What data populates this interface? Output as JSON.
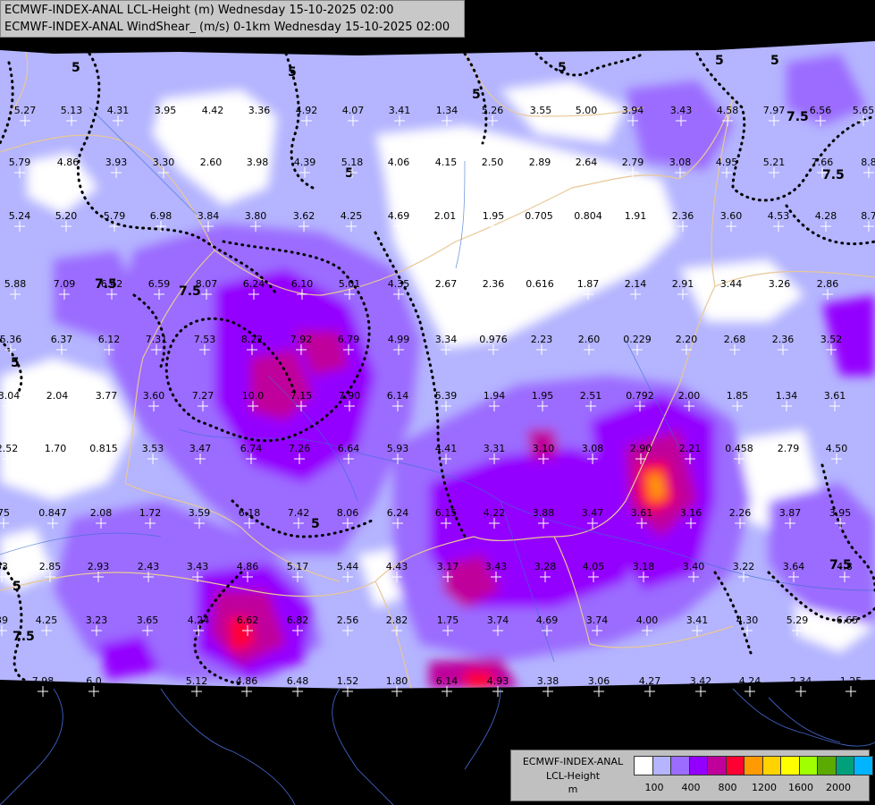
{
  "title": {
    "line1": "ECMWF-INDEX-ANAL LCL-Height (m) Wednesday 15-10-2025 02:00",
    "line2": "ECMWF-INDEX-ANAL WindShear_ (m/s) 0-1km Wednesday 15-10-2025 02:00"
  },
  "legend": {
    "line1": "ECMWF-INDEX-ANAL",
    "line2": "LCL-Height",
    "line3": "m",
    "colors": [
      "#ffffff",
      "#b4b4ff",
      "#9b6cff",
      "#9400ff",
      "#c0009b",
      "#ff0033",
      "#ff9a00",
      "#ffd300",
      "#ffff00",
      "#a0ff00",
      "#5aaa00",
      "#00a07a",
      "#00b4ff"
    ],
    "ticks": [
      "100",
      "400",
      "800",
      "1200",
      "1600",
      "2000"
    ]
  },
  "contour_labels": [
    "5",
    "5",
    "5",
    "5",
    "5",
    "5",
    "5",
    "7.5",
    "7.5",
    "7.5",
    "5",
    "5",
    "5",
    "7.5",
    "7.5",
    "7.5"
  ],
  "values": [
    "5.27",
    "5.13",
    "4.31",
    "3.95",
    "4.42",
    "3.36",
    "4.92",
    "4.07",
    "3.41",
    "1.34",
    "5.26",
    "3.55",
    "5.00",
    "3.94",
    "3.43",
    "4.58",
    "7.97",
    "6.56",
    "5.65",
    "5.79",
    "4.86",
    "3.93",
    "3.30",
    "2.60",
    "3.98",
    "4.39",
    "5.18",
    "4.06",
    "4.15",
    "2.50",
    "2.89",
    "2.64",
    "2.79",
    "3.08",
    "4.95",
    "5.21",
    "7.66",
    "8.8",
    "5.24",
    "5.20",
    "5.79",
    "6.98",
    "3.84",
    "3.80",
    "3.62",
    "4.25",
    "4.69",
    "2.01",
    "1.95",
    "0.705",
    "0.804",
    "1.91",
    "2.36",
    "3.60",
    "4.53",
    "4.28",
    "8.7",
    "5.88",
    "7.09",
    "6.42",
    "6.59",
    "8.07",
    "6.24",
    "6.10",
    "5.01",
    "4.35",
    "2.67",
    "2.36",
    "0.616",
    "1.87",
    "2.14",
    "2.91",
    "3.44",
    "3.26",
    "2.86",
    "5.36",
    "6.37",
    "6.12",
    "7.31",
    "7.53",
    "8.22",
    "7.92",
    "6.79",
    "4.99",
    "3.34",
    "0.976",
    "2.23",
    "2.60",
    "0.229",
    "2.20",
    "2.68",
    "2.36",
    "3.52",
    "3.04",
    "2.04",
    "3.77",
    "3.60",
    "7.27",
    "10.0",
    "7.15",
    "7.90",
    "6.14",
    "5.39",
    "1.94",
    "1.95",
    "2.51",
    "0.792",
    "2.00",
    "1.85",
    "1.34",
    "3.61",
    "2.52",
    "1.70",
    "0.815",
    "3.53",
    "3.47",
    "6.74",
    "7.26",
    "6.64",
    "5.93",
    "4.41",
    "3.31",
    "3.10",
    "3.08",
    "2.90",
    "2.21",
    "0.458",
    "2.79",
    "4.50",
    "75",
    "0.847",
    "2.08",
    "1.72",
    "3.59",
    "6.18",
    "7.42",
    "8.06",
    "6.24",
    "6.15",
    "4.22",
    "3.88",
    "3.47",
    "3.61",
    "3.16",
    "2.26",
    "3.87",
    "3.95",
    "53",
    "2.85",
    "2.93",
    "2.43",
    "3.43",
    "4.86",
    "5.17",
    "5.44",
    "4.43",
    "3.17",
    "3.43",
    "3.28",
    "4.05",
    "3.18",
    "3.40",
    "3.22",
    "3.64",
    "4.8",
    "39",
    "4.25",
    "3.23",
    "3.65",
    "4.24",
    "6.62",
    "6.82",
    "2.56",
    "2.82",
    "1.75",
    "3.74",
    "4.69",
    "3.74",
    "4.00",
    "3.41",
    "4.30",
    "5.29",
    "6.65",
    "7.98",
    "6.0",
    "5.12",
    "4.86",
    "6.48",
    "1.52",
    "1.80",
    "6.14",
    "4.93",
    "3.38",
    "3.06",
    "4.27",
    "3.42",
    "4.24",
    "2.34",
    "1.25"
  ]
}
